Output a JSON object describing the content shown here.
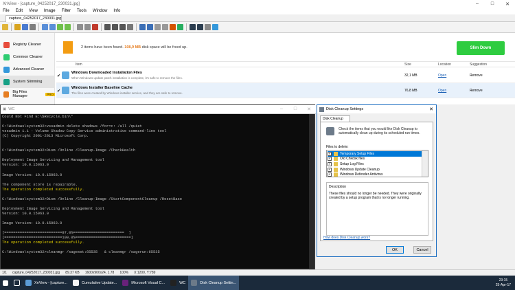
{
  "xnview": {
    "title": "XnView - [capture_04252017_230031.jpg]",
    "menu": [
      "File",
      "Edit",
      "View",
      "Image",
      "Filter",
      "Tools",
      "Window",
      "Info"
    ],
    "tab": "capture_04252017_230031.jpg"
  },
  "cleaner": {
    "sidebar": [
      {
        "label": "Registry Cleaner",
        "color": "#e74c3c"
      },
      {
        "label": "Common Cleaner",
        "color": "#2ecc71"
      },
      {
        "label": "Advanced Cleaner",
        "color": "#3498db"
      },
      {
        "label": "System Slimming",
        "color": "#16a085"
      },
      {
        "label": "Big Files Manager",
        "color": "#e67e22",
        "badge": "PRO"
      }
    ],
    "summary_pre": "2 items have been found.",
    "summary_size": "108,9 MB",
    "summary_post": "disk space will be freed up.",
    "slim_button": "Slim Down",
    "columns": {
      "item": "Item",
      "size": "Size",
      "location": "Location",
      "suggestion": "Suggestion"
    },
    "rows": [
      {
        "name": "Windows Downloaded Installation Files",
        "desc": "When Windows update patch installation is complete, it's safe to remove the files.",
        "size": "32,1 MB",
        "location": "Open",
        "suggestion": "Remove"
      },
      {
        "name": "Windows Installer Baseline Cache",
        "desc": "The files were created by Windows installer service, and they are safe to remove.",
        "size": "76,8 MB",
        "location": "Open",
        "suggestion": "Remove"
      }
    ]
  },
  "cmd": {
    "title": "WC",
    "lines": [
      "Could Not Find E:\\$Recycle.bin\\*",
      "",
      "C:\\Windows\\system32>vssadmin delete shadows /for=c: /all /quiet",
      "vssadmin 1.1 - Volume Shadow Copy Service administrative command-line tool",
      "(C) Copyright 2001-2013 Microsoft Corp.",
      "",
      "",
      "C:\\Windows\\system32>Dism /Online /Cleanup-Image /CheckHealth",
      "",
      "Deployment Image Servicing and Management tool",
      "Version: 10.0.15063.0",
      "",
      "Image Version: 10.0.15063.0",
      "",
      "The component store is repairable.",
      "The operation completed successfully.",
      "",
      "C:\\Windows\\system32>Dism /Online /Cleanup-Image /StartComponentCleanup /ResetBase",
      "",
      "Deployment Image Servicing and Management tool",
      "Version: 10.0.15063.0",
      "",
      "Image Version: 10.0.15063.0",
      "",
      "[==========================97.0%=======================  ]",
      "[==========================100.0%=========================]",
      "The operation completed successfully.",
      "",
      "C:\\Windows\\system32>cleanmgr /sageset:65535   & cleanmgr /sagerun:65535"
    ],
    "highlight_line": "The operation completed"
  },
  "dialog": {
    "title": "Disk Cleanup Settings",
    "tab": "Disk Cleanup",
    "intro": "Check the items that you would like Disk Cleanup to automatically clean up during its scheduled run times.",
    "files_label": "Files to delete:",
    "files": [
      {
        "label": "Temporary Setup Files",
        "checked": true,
        "selected": true
      },
      {
        "label": "Old Chkdsk files",
        "checked": true,
        "selected": false
      },
      {
        "label": "Setup Log Files",
        "checked": true,
        "selected": false
      },
      {
        "label": "Windows Update Cleanup",
        "checked": true,
        "selected": false
      },
      {
        "label": "Windows Defender Antivirus",
        "checked": true,
        "selected": false
      }
    ],
    "desc_label": "Description",
    "desc_text": "These files should no longer be needed. They were originally created by a setup program that is no longer running.",
    "link": "How does Disk Cleanup work?",
    "ok": "OK",
    "cancel": "Cancel"
  },
  "status": [
    "1/1",
    "capture_04252017_230031.jpg",
    "89.37 KB",
    "1600x900x24, 1.78",
    "100%",
    "X:1200, Y:789"
  ],
  "taskbar": {
    "items": [
      {
        "label": "XnView - [capture...",
        "color": "#5b9bd5",
        "active": false
      },
      {
        "label": "Cumulative Update...",
        "color": "#f5f5f5",
        "active": false
      },
      {
        "label": "Microsoft Visual C...",
        "color": "#68217a",
        "active": false
      },
      {
        "label": "WC",
        "color": "#222",
        "active": false
      },
      {
        "label": "Disk Cleanup Settin...",
        "color": "#6c7a89",
        "active": true
      }
    ],
    "time": "23:15",
    "date": "25-Apr-17"
  }
}
